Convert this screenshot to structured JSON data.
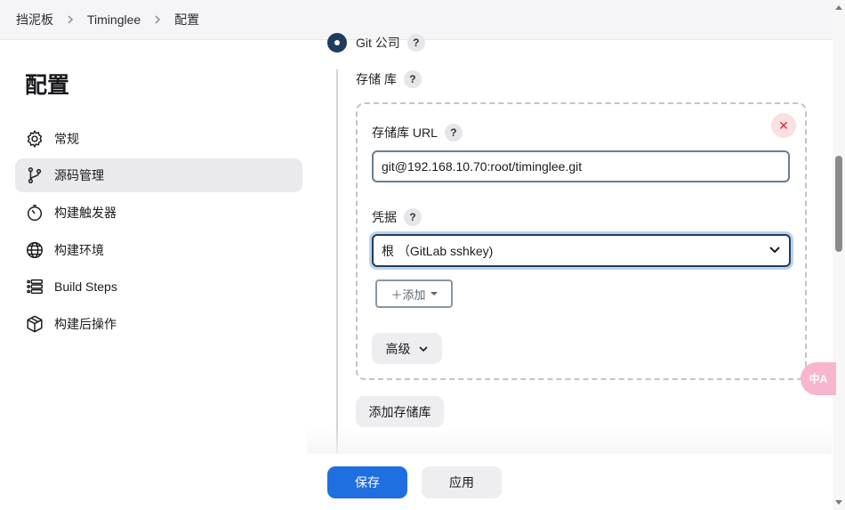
{
  "breadcrumb": {
    "items": [
      "挡泥板",
      "Timinglee",
      "配置"
    ]
  },
  "page": {
    "title": "配置"
  },
  "sidebar": {
    "items": [
      {
        "label": "常规",
        "icon": "gear-icon"
      },
      {
        "label": "源码管理",
        "icon": "branch-icon",
        "active": true
      },
      {
        "label": "构建触发器",
        "icon": "timer-icon"
      },
      {
        "label": "构建环境",
        "icon": "globe-icon"
      },
      {
        "label": "Build Steps",
        "icon": "list-icon"
      },
      {
        "label": "构建后操作",
        "icon": "package-icon"
      }
    ]
  },
  "scm": {
    "option_label": "Git 公司",
    "repositories_label": "存储 库",
    "repo_url_label": "存储库 URL",
    "repo_url_value": "git@192.168.10.70:root/timinglee.git",
    "credentials_label": "凭据",
    "credentials_selected": "根 （GitLab sshkey)",
    "add_label": "＋添加",
    "advanced_label": "高级",
    "add_repo_label": "添加存储库",
    "help_glyph": "?",
    "remove_glyph": "✕"
  },
  "translate_badge": "中A",
  "footer": {
    "save_label": "保存",
    "apply_label": "应用"
  },
  "colors": {
    "primary": "#1f6fe0",
    "danger": "#d02f3f",
    "accent_dark": "#1e3d5c"
  }
}
